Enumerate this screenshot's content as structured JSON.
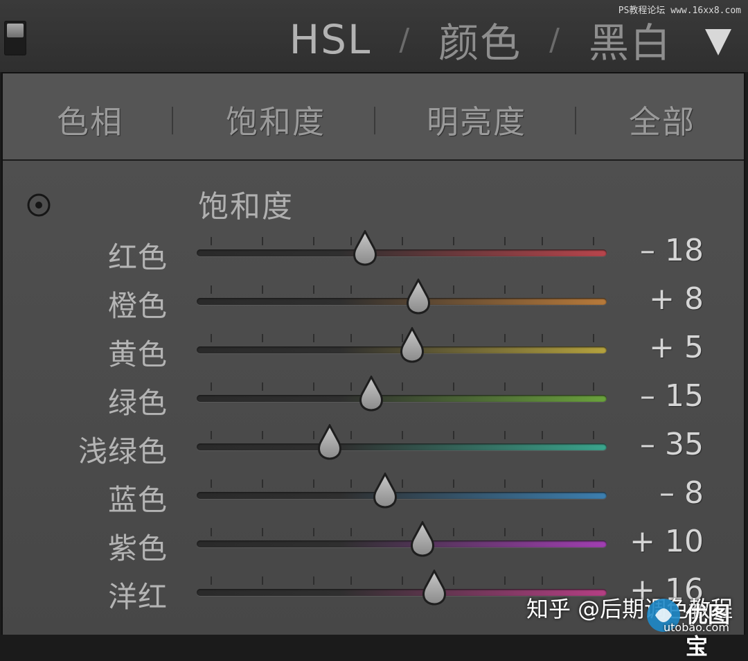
{
  "watermark_top": "PS教程论坛 www.16xx8.com",
  "header": {
    "tab_hsl": "HSL",
    "sep1": "/",
    "tab_color": "颜色",
    "sep2": "/",
    "tab_bw": "黑白"
  },
  "subtabs": [
    {
      "label": "色相",
      "active": true
    },
    {
      "label": "饱和度",
      "active": true
    },
    {
      "label": "明亮度",
      "active": false
    },
    {
      "label": "全部",
      "active": false
    }
  ],
  "section_title": "饱和度",
  "sliders": [
    {
      "label": "红色",
      "value_text": "– 18",
      "value": -18,
      "color": "#b8454c"
    },
    {
      "label": "橙色",
      "value_text": "+ 8",
      "value": 8,
      "color": "#b87a3a"
    },
    {
      "label": "黄色",
      "value_text": "+ 5",
      "value": 5,
      "color": "#b5a23e"
    },
    {
      "label": "绿色",
      "value_text": "– 15",
      "value": -15,
      "color": "#6aa23c"
    },
    {
      "label": "浅绿色",
      "value_text": "– 35",
      "value": -35,
      "color": "#3aa58d"
    },
    {
      "label": "蓝色",
      "value_text": "– 8",
      "value": -8,
      "color": "#3c7fb0"
    },
    {
      "label": "紫色",
      "value_text": "+ 10",
      "value": 10,
      "color": "#a13fb2"
    },
    {
      "label": "洋红",
      "value_text": "+ 16",
      "value": 16,
      "color": "#b53f84"
    }
  ],
  "overlay": {
    "zhihu_text": "知乎 @后期调色教程",
    "brand_name": "优图宝",
    "brand_url": "utobao.com"
  },
  "colors": {
    "panel_bg": "#4a4a4a",
    "track_dark": "#2a2a2a"
  }
}
